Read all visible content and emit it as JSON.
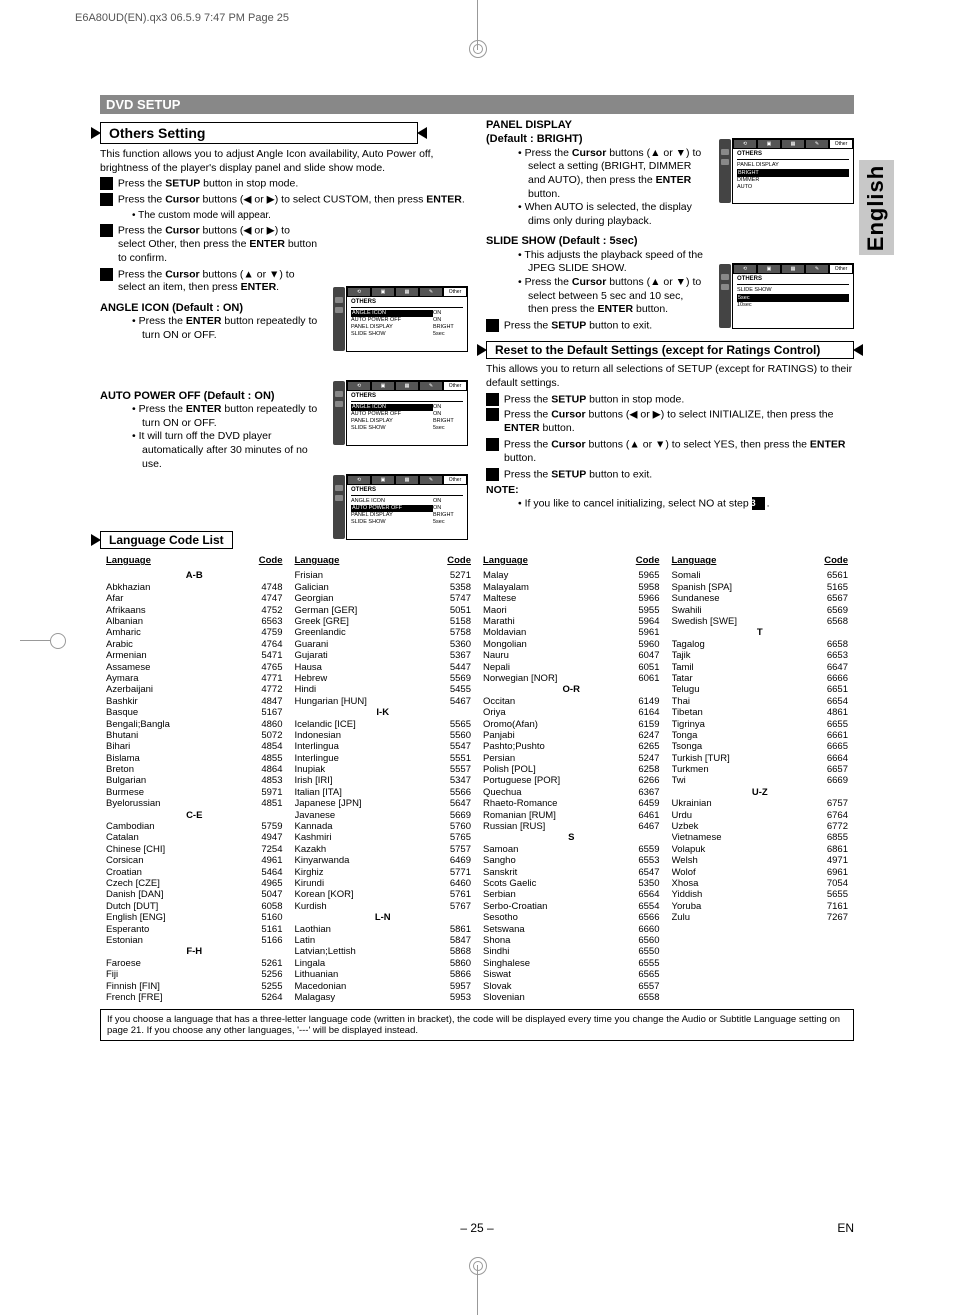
{
  "header": "E6A80UD(EN).qx3   06.5.9  7:47 PM  Page 25",
  "side_tab": "English",
  "section_bar": "DVD SETUP",
  "others_heading": "Others Setting",
  "others_intro": "This function allows you to adjust Angle Icon availability, Auto Power off, brightness of the player's display panel and slide show mode.",
  "step1": "Press the SETUP button in stop mode.",
  "step2": "Press the Cursor buttons (◀ or ▶) to select CUSTOM, then press ENTER.",
  "step2_sub": "• The custom mode will appear.",
  "step3": "Press the Cursor buttons (◀ or ▶) to select Other, then press the ENTER button to confirm.",
  "step4": "Press the Cursor buttons (▲ or ▼) to select an item, then press ENTER.",
  "angle_head": "ANGLE ICON (Default : ON)",
  "angle_b1": "• Press the ENTER button repeatedly to turn ON or OFF.",
  "auto_head": "AUTO POWER OFF (Default : ON)",
  "auto_b1": "• Press the ENTER button repeatedly to turn  ON or OFF.",
  "auto_b2": "• It will turn off the DVD player automatically after 30 minutes of no use.",
  "panel_head": "PANEL DISPLAY",
  "panel_def": "(Default : BRIGHT)",
  "panel_b1": "• Press the Cursor buttons (▲ or ▼) to select a setting (BRIGHT, DIMMER and AUTO), then press the ENTER button.",
  "panel_b2": "• When AUTO is selected, the display dims only during playback.",
  "slide_head": "SLIDE SHOW (Default : 5sec)",
  "slide_b1": "• This adjusts the playback speed of the JPEG SLIDE SHOW.",
  "slide_b2": "• Press the Cursor buttons (▲ or ▼) to select between 5 sec and 10 sec, then press the ENTER button.",
  "step5": "Press the SETUP button to exit.",
  "reset_head": "Reset to the Default Settings (except for Ratings Control)",
  "reset_intro": "This allows you to return all selections of SETUP (except for RATINGS) to their default settings.",
  "rstep1": "Press the SETUP button in stop mode.",
  "rstep2": "Press the Cursor buttons (◀ or ▶) to select INITIALIZE, then press the ENTER button.",
  "rstep3": "Press the Cursor buttons (▲ or ▼) to select YES, then press the ENTER button.",
  "rstep4": "Press the SETUP button to exit.",
  "note_label": "NOTE:",
  "note_text": "• If you like to cancel initializing, select NO at step",
  "lang_head": "Language Code List",
  "lang_col_hdr": {
    "lang": "Language",
    "code": "Code"
  },
  "lang_cols": [
    [
      {
        "g": "A-B"
      },
      {
        "l": "Abkhazian",
        "c": "4748"
      },
      {
        "l": "Afar",
        "c": "4747"
      },
      {
        "l": "Afrikaans",
        "c": "4752"
      },
      {
        "l": "Albanian",
        "c": "6563"
      },
      {
        "l": "Amharic",
        "c": "4759"
      },
      {
        "l": "Arabic",
        "c": "4764"
      },
      {
        "l": "Armenian",
        "c": "5471"
      },
      {
        "l": "Assamese",
        "c": "4765"
      },
      {
        "l": "Aymara",
        "c": "4771"
      },
      {
        "l": "Azerbaijani",
        "c": "4772"
      },
      {
        "l": "Bashkir",
        "c": "4847"
      },
      {
        "l": "Basque",
        "c": "5167"
      },
      {
        "l": "Bengali;Bangla",
        "c": "4860"
      },
      {
        "l": "Bhutani",
        "c": "5072"
      },
      {
        "l": "Bihari",
        "c": "4854"
      },
      {
        "l": "Bislama",
        "c": "4855"
      },
      {
        "l": "Breton",
        "c": "4864"
      },
      {
        "l": "Bulgarian",
        "c": "4853"
      },
      {
        "l": "Burmese",
        "c": "5971"
      },
      {
        "l": "Byelorussian",
        "c": "4851"
      },
      {
        "g": "C-E"
      },
      {
        "l": "Cambodian",
        "c": "5759"
      },
      {
        "l": "Catalan",
        "c": "4947"
      },
      {
        "l": "Chinese [CHI]",
        "c": "7254"
      },
      {
        "l": "Corsican",
        "c": "4961"
      },
      {
        "l": "Croatian",
        "c": "5464"
      },
      {
        "l": "Czech [CZE]",
        "c": "4965"
      },
      {
        "l": "Danish [DAN]",
        "c": "5047"
      },
      {
        "l": "Dutch [DUT]",
        "c": "6058"
      },
      {
        "l": "English [ENG]",
        "c": "5160"
      },
      {
        "l": "Esperanto",
        "c": "5161"
      },
      {
        "l": "Estonian",
        "c": "5166"
      },
      {
        "g": "F-H"
      },
      {
        "l": "Faroese",
        "c": "5261"
      },
      {
        "l": "Fiji",
        "c": "5256"
      },
      {
        "l": "Finnish [FIN]",
        "c": "5255"
      },
      {
        "l": "French [FRE]",
        "c": "5264"
      }
    ],
    [
      {
        "l": "Frisian",
        "c": "5271"
      },
      {
        "l": "Galician",
        "c": "5358"
      },
      {
        "l": "Georgian",
        "c": "5747"
      },
      {
        "l": "German [GER]",
        "c": "5051"
      },
      {
        "l": "Greek [GRE]",
        "c": "5158"
      },
      {
        "l": "Greenlandic",
        "c": "5758"
      },
      {
        "l": "Guarani",
        "c": "5360"
      },
      {
        "l": "Gujarati",
        "c": "5367"
      },
      {
        "l": "Hausa",
        "c": "5447"
      },
      {
        "l": "Hebrew",
        "c": "5569"
      },
      {
        "l": "Hindi",
        "c": "5455"
      },
      {
        "l": "Hungarian [HUN]",
        "c": "5467"
      },
      {
        "g": "I-K"
      },
      {
        "l": "Icelandic [ICE]",
        "c": "5565"
      },
      {
        "l": "Indonesian",
        "c": "5560"
      },
      {
        "l": "Interlingua",
        "c": "5547"
      },
      {
        "l": "Interlingue",
        "c": "5551"
      },
      {
        "l": "Inupiak",
        "c": "5557"
      },
      {
        "l": "Irish [IRI]",
        "c": "5347"
      },
      {
        "l": "Italian [ITA]",
        "c": "5566"
      },
      {
        "l": "Japanese [JPN]",
        "c": "5647"
      },
      {
        "l": "Javanese",
        "c": "5669"
      },
      {
        "l": "Kannada",
        "c": "5760"
      },
      {
        "l": "Kashmiri",
        "c": "5765"
      },
      {
        "l": "Kazakh",
        "c": "5757"
      },
      {
        "l": "Kinyarwanda",
        "c": "6469"
      },
      {
        "l": "Kirghiz",
        "c": "5771"
      },
      {
        "l": "Kirundi",
        "c": "6460"
      },
      {
        "l": "Korean [KOR]",
        "c": "5761"
      },
      {
        "l": "Kurdish",
        "c": "5767"
      },
      {
        "g": "L-N"
      },
      {
        "l": "Laothian",
        "c": "5861"
      },
      {
        "l": "Latin",
        "c": "5847"
      },
      {
        "l": "Latvian;Lettish",
        "c": "5868"
      },
      {
        "l": "Lingala",
        "c": "5860"
      },
      {
        "l": "Lithuanian",
        "c": "5866"
      },
      {
        "l": "Macedonian",
        "c": "5957"
      },
      {
        "l": "Malagasy",
        "c": "5953"
      }
    ],
    [
      {
        "l": "Malay",
        "c": "5965"
      },
      {
        "l": "Malayalam",
        "c": "5958"
      },
      {
        "l": "Maltese",
        "c": "5966"
      },
      {
        "l": "Maori",
        "c": "5955"
      },
      {
        "l": "Marathi",
        "c": "5964"
      },
      {
        "l": "Moldavian",
        "c": "5961"
      },
      {
        "l": "Mongolian",
        "c": "5960"
      },
      {
        "l": "Nauru",
        "c": "6047"
      },
      {
        "l": "Nepali",
        "c": "6051"
      },
      {
        "l": "Norwegian [NOR]",
        "c": "6061"
      },
      {
        "g": "O-R"
      },
      {
        "l": "Occitan",
        "c": "6149"
      },
      {
        "l": "Oriya",
        "c": "6164"
      },
      {
        "l": "Oromo(Afan)",
        "c": "6159"
      },
      {
        "l": "Panjabi",
        "c": "6247"
      },
      {
        "l": "Pashto;Pushto",
        "c": "6265"
      },
      {
        "l": "Persian",
        "c": "5247"
      },
      {
        "l": "Polish [POL]",
        "c": "6258"
      },
      {
        "l": "Portuguese [POR]",
        "c": "6266"
      },
      {
        "l": "Quechua",
        "c": "6367"
      },
      {
        "l": "Rhaeto-Romance",
        "c": "6459"
      },
      {
        "l": "Romanian [RUM]",
        "c": "6461"
      },
      {
        "l": "Russian [RUS]",
        "c": "6467"
      },
      {
        "g": "S"
      },
      {
        "l": "Samoan",
        "c": "6559"
      },
      {
        "l": "Sangho",
        "c": "6553"
      },
      {
        "l": "Sanskrit",
        "c": "6547"
      },
      {
        "l": "Scots Gaelic",
        "c": "5350"
      },
      {
        "l": "Serbian",
        "c": "6564"
      },
      {
        "l": "Serbo-Croatian",
        "c": "6554"
      },
      {
        "l": "Sesotho",
        "c": "6566"
      },
      {
        "l": "Setswana",
        "c": "6660"
      },
      {
        "l": "Shona",
        "c": "6560"
      },
      {
        "l": "Sindhi",
        "c": "6550"
      },
      {
        "l": "Singhalese",
        "c": "6555"
      },
      {
        "l": "Siswat",
        "c": "6565"
      },
      {
        "l": "Slovak",
        "c": "6557"
      },
      {
        "l": "Slovenian",
        "c": "6558"
      }
    ],
    [
      {
        "l": "Somali",
        "c": "6561"
      },
      {
        "l": "Spanish [SPA]",
        "c": "5165"
      },
      {
        "l": "Sundanese",
        "c": "6567"
      },
      {
        "l": "Swahili",
        "c": "6569"
      },
      {
        "l": "Swedish [SWE]",
        "c": "6568"
      },
      {
        "g": "T"
      },
      {
        "l": "Tagalog",
        "c": "6658"
      },
      {
        "l": "Tajik",
        "c": "6653"
      },
      {
        "l": "Tamil",
        "c": "6647"
      },
      {
        "l": "Tatar",
        "c": "6666"
      },
      {
        "l": "Telugu",
        "c": "6651"
      },
      {
        "l": "Thai",
        "c": "6654"
      },
      {
        "l": "Tibetan",
        "c": "4861"
      },
      {
        "l": "Tigrinya",
        "c": "6655"
      },
      {
        "l": "Tonga",
        "c": "6661"
      },
      {
        "l": "Tsonga",
        "c": "6665"
      },
      {
        "l": "Turkish [TUR]",
        "c": "6664"
      },
      {
        "l": "Turkmen",
        "c": "6657"
      },
      {
        "l": "Twi",
        "c": "6669"
      },
      {
        "g": "U-Z"
      },
      {
        "l": "Ukrainian",
        "c": "6757"
      },
      {
        "l": "Urdu",
        "c": "6764"
      },
      {
        "l": "Uzbek",
        "c": "6772"
      },
      {
        "l": "Vietnamese",
        "c": "6855"
      },
      {
        "l": "Volapuk",
        "c": "6861"
      },
      {
        "l": "Welsh",
        "c": "4971"
      },
      {
        "l": "Wolof",
        "c": "6961"
      },
      {
        "l": "Xhosa",
        "c": "7054"
      },
      {
        "l": "Yiddish",
        "c": "5655"
      },
      {
        "l": "Yoruba",
        "c": "7161"
      },
      {
        "l": "Zulu",
        "c": "7267"
      }
    ]
  ],
  "footnote": "If you choose a language that has a three-letter language code (written in bracket), the code will be displayed every time you change the Audio or Subtitle Language setting on page 21. If you choose any other languages, '---' will be displayed instead.",
  "pagenum": "– 25 –",
  "pagenum_en": "EN",
  "osd_others": {
    "title": "OTHERS",
    "rows": [
      [
        "ANGLE ICON",
        "ON"
      ],
      [
        "AUTO POWER OFF",
        "ON"
      ],
      [
        "PANEL DISPLAY",
        "BRIGHT"
      ],
      [
        "SLIDE SHOW",
        "5sec"
      ]
    ]
  },
  "osd_panel": {
    "title": "OTHERS",
    "sub": "PANEL DISPLAY",
    "rows": [
      [
        "BRIGHT",
        ""
      ],
      [
        "DIMMER",
        ""
      ],
      [
        "AUTO",
        ""
      ]
    ]
  },
  "osd_slide": {
    "title": "OTHERS",
    "sub": "SLIDE SHOW",
    "rows": [
      [
        "5sec",
        ""
      ],
      [
        "10sec",
        ""
      ]
    ]
  }
}
